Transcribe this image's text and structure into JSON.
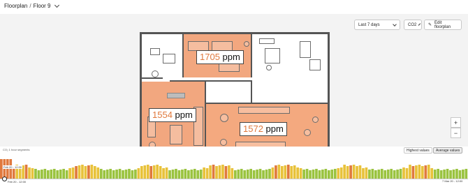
{
  "breadcrumb": {
    "root": "Floorplan",
    "separator": "/",
    "current": "Floor 9"
  },
  "controls": {
    "range_label": "Last 7 days",
    "metric_label": "CO2",
    "edit_label": "Edit floorplan",
    "zoom_in": "+",
    "zoom_out": "−"
  },
  "rooms": [
    {
      "value": "1705",
      "unit": "ppm",
      "color": "#f2a77f"
    },
    {
      "value": "1554",
      "unit": "ppm",
      "color": "#f2a77f"
    },
    {
      "value": "1572",
      "unit": "ppm",
      "color": "#f4a97f"
    }
  ],
  "timeline": {
    "title": "CO₂ 1 hour segments",
    "toggle_highest": "Highest values",
    "toggle_average": "Average values",
    "active_toggle": "average",
    "start_label": "Feb 20 - 12:00",
    "end_label": "7 Mar 20 - 12:00",
    "current_label": "Feb 20 - 12:00",
    "colors": {
      "high": "#e0793d",
      "mid": "#e8c23a",
      "low": "#9ac33f"
    },
    "bar_count": 150
  }
}
